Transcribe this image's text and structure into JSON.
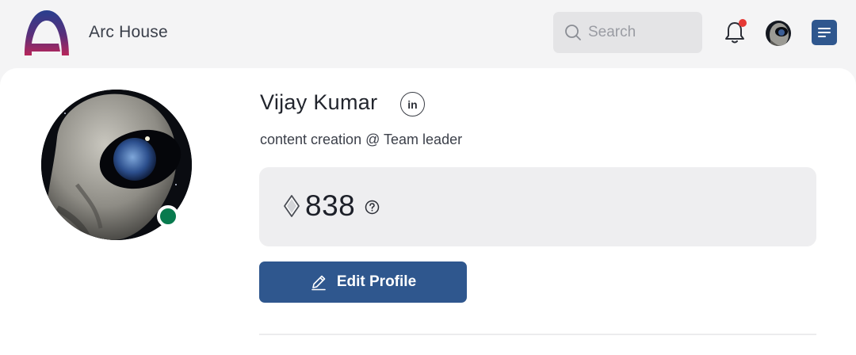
{
  "header": {
    "app_title": "Arc House",
    "search_placeholder": "Search",
    "logo_icon": "arc-house-logo",
    "bell_icon": "bell-icon",
    "menu_icon": "menu-icon"
  },
  "profile": {
    "name": "Vijay Kumar",
    "linkedin_label": "in",
    "role": "content creation @ Team leader",
    "points": "838",
    "status": "online",
    "edit_label": "Edit Profile"
  },
  "colors": {
    "primary": "#2f578e",
    "online": "#087a4e",
    "notification": "#e53935",
    "logo_top": "#2a3e8c",
    "logo_bottom": "#b8265a"
  }
}
